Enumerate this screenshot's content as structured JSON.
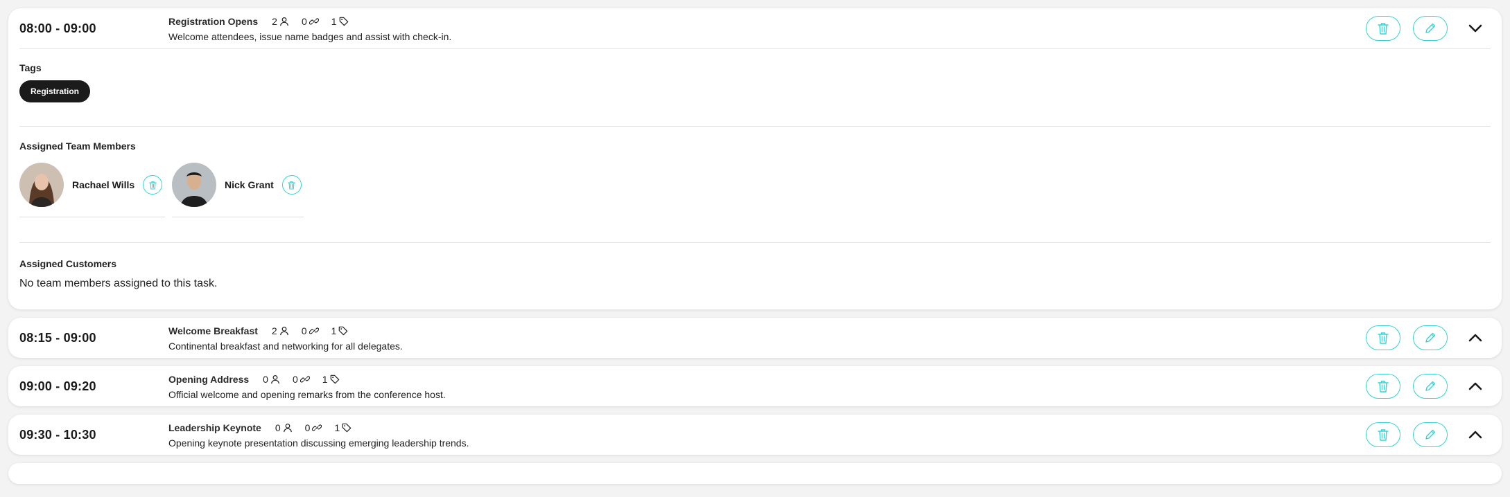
{
  "colors": {
    "accent": "#35d3d6",
    "tag_bg": "#1b1b1b",
    "page_bg": "#f3f3f3"
  },
  "tasks": [
    {
      "time": "08:00 - 09:00",
      "title": "Registration Opens",
      "members_count": "2",
      "links_count": "0",
      "tags_count": "1",
      "description": "Welcome attendees, issue name badges and assist with check-in.",
      "chevron": "chevron-down-icon"
    },
    {
      "time": "08:15 - 09:00",
      "title": "Welcome Breakfast",
      "members_count": "2",
      "links_count": "0",
      "tags_count": "1",
      "description": "Continental breakfast and networking for all delegates.",
      "chevron": "chevron-up-icon"
    },
    {
      "time": "09:00 - 09:20",
      "title": "Opening Address",
      "members_count": "0",
      "links_count": "0",
      "tags_count": "1",
      "description": "Official welcome and opening remarks from the conference host.",
      "chevron": "chevron-up-icon"
    },
    {
      "time": "09:30 - 10:30",
      "title": "Leadership Keynote",
      "members_count": "0",
      "links_count": "0",
      "tags_count": "1",
      "description": "Opening keynote presentation discussing emerging leadership trends.",
      "chevron": "chevron-up-icon"
    }
  ],
  "details": {
    "tags_title": "Tags",
    "tags": [
      "Registration"
    ],
    "team_title": "Assigned Team Members",
    "team": [
      {
        "name": "Rachael Wills"
      },
      {
        "name": "Nick Grant"
      }
    ],
    "customers_title": "Assigned Customers",
    "customers_empty": "No team members assigned to this task."
  }
}
